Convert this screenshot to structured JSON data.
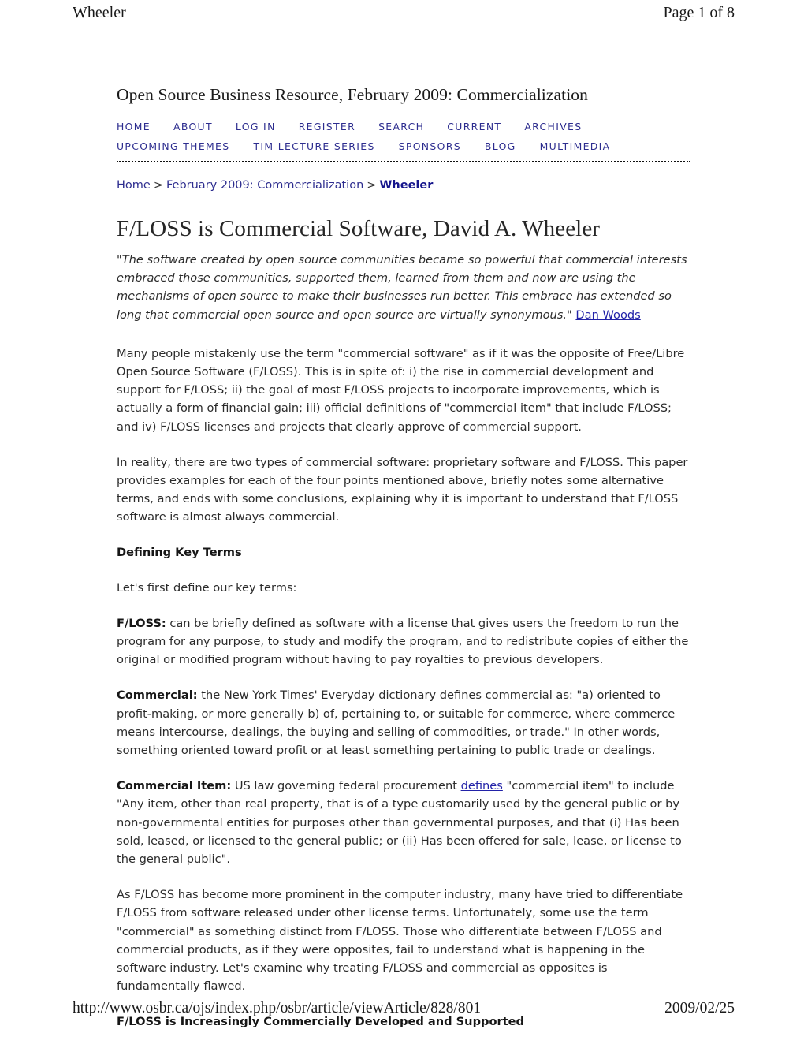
{
  "print_header": {
    "left": "Wheeler",
    "right": "Page 1 of 8"
  },
  "print_footer": {
    "url": "http://www.osbr.ca/ojs/index.php/osbr/article/viewArticle/828/801",
    "date": "2009/02/25"
  },
  "site": {
    "title": "Open Source Business Resource, February 2009: Commercialization",
    "nav_row_1": [
      "HOME",
      "ABOUT",
      "LOG IN",
      "REGISTER",
      "SEARCH",
      "CURRENT",
      "ARCHIVES"
    ],
    "nav_row_2": [
      "UPCOMING THEMES",
      "TIM LECTURE SERIES",
      "SPONSORS",
      "BLOG",
      "MULTIMEDIA"
    ]
  },
  "breadcrumb": {
    "home": "Home",
    "sep1": ">",
    "issue": "February 2009: Commercialization",
    "sep2": ">",
    "current": "Wheeler"
  },
  "article": {
    "title": "F/LOSS is Commercial Software, David A. Wheeler",
    "pullquote": {
      "text": "\"The software created by open source communities became so powerful that commercial interests embraced those communities, supported them, learned from them and now are using the mechanisms of open source to make their businesses run better. This embrace has extended so long that commercial open source and open source are virtually synonymous.\"",
      "attribution_link": "Dan Woods"
    },
    "p1": "Many people mistakenly use the term \"commercial software\" as if it was the opposite of Free/Libre Open Source Software (F/LOSS). This is in spite of: i) the rise in commercial development and support for F/LOSS; ii) the goal of most F/LOSS projects to incorporate improvements, which is actually a form of financial gain; iii) official definitions of \"commercial item\" that include F/LOSS; and iv) F/LOSS licenses and projects that clearly approve of commercial support.",
    "p2": "In reality, there are two types of commercial software: proprietary software and F/LOSS. This paper provides examples for each of the four points mentioned above, briefly notes some alternative terms, and ends with some conclusions, explaining why it is important to understand that F/LOSS software is almost always commercial.",
    "heading_defining_key_terms": "Defining Key Terms",
    "p3": "Let's first define our key terms:",
    "def_floss_term": "F/LOSS:",
    "def_floss_text": " can be briefly defined as software with a license that gives users the freedom to run the program for any purpose, to study and modify the program, and to redistribute copies of either the original or modified program without having to pay royalties to previous developers.",
    "def_commercial_term": "Commercial:",
    "def_commercial_text": " the New York Times' Everyday dictionary defines commercial as: \"a) oriented to profit-making, or more generally b) of, pertaining to, or suitable for commerce, where commerce means intercourse, dealings, the buying and selling of commodities, or trade.\" In other words, something oriented toward profit or at least something pertaining to public trade or dealings.",
    "def_item_term": "Commercial Item:",
    "def_item_text_1": " US law governing federal procurement ",
    "def_item_link": "defines",
    "def_item_text_2": " \"commercial item\" to include \"Any item, other than real property, that is of a type customarily used by the general public or by non-governmental entities for purposes other than governmental purposes, and that (i) Has been sold, leased, or licensed to the general public; or (ii) Has been offered for sale, lease, or license to the general public\".",
    "p4": "As F/LOSS has become more prominent in the computer industry, many have tried to differentiate F/LOSS from software released under other license terms. Unfortunately, some use the term \"commercial\" as something distinct from F/LOSS. Those who differentiate between F/LOSS and commercial products, as if they were opposites, fail to understand what is happening in the software industry. Let's examine why treating F/LOSS and commercial as opposites is fundamentally flawed.",
    "heading_increasingly": "F/LOSS is Increasingly Commercially Developed and Supported"
  },
  "colors": {
    "nav_link": "#2d2d8f",
    "body_text": "#2b2b2b",
    "inline_link": "#2222a8",
    "divider": "#111111"
  }
}
